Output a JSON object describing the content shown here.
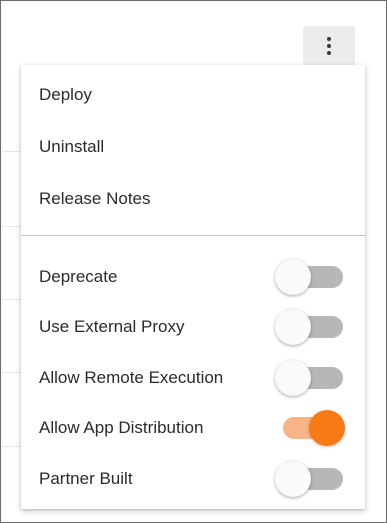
{
  "header": {
    "more_actions_icon": "more-vertical-icon"
  },
  "menu": {
    "actions": [
      {
        "label": "Deploy"
      },
      {
        "label": "Uninstall"
      },
      {
        "label": "Release Notes"
      }
    ],
    "toggles": [
      {
        "label": "Deprecate",
        "on": false
      },
      {
        "label": "Use External Proxy",
        "on": false
      },
      {
        "label": "Allow Remote Execution",
        "on": false
      },
      {
        "label": "Allow App Distribution",
        "on": true
      },
      {
        "label": "Partner Built",
        "on": false
      }
    ]
  },
  "colors": {
    "accent": "#f97a15",
    "accent_track": "#f7b489",
    "toggle_off_track": "#b7b7b7",
    "text": "#2b2b2b"
  }
}
